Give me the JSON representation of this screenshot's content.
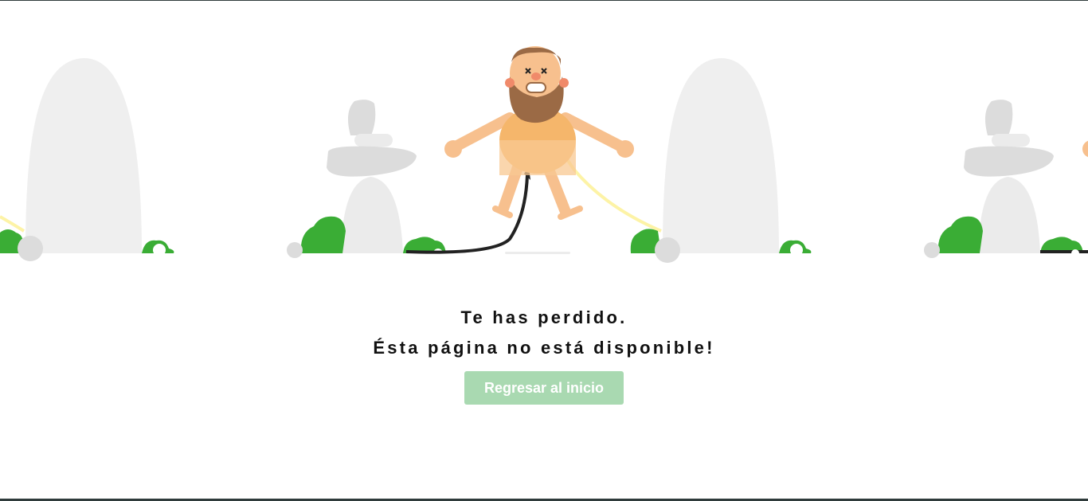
{
  "message": {
    "line1": "Te has perdido.",
    "line2": "Ésta página no está disponible!"
  },
  "home_button": {
    "label": "Regresar al inicio"
  },
  "colors": {
    "button_bg": "#a9d9b1",
    "stone": "#efefef",
    "cairn": "#dcdcdc",
    "bush": "#3aad35",
    "skin": "#f7c08e",
    "tunic": "#f5b66b",
    "beard": "#9b6a45"
  }
}
